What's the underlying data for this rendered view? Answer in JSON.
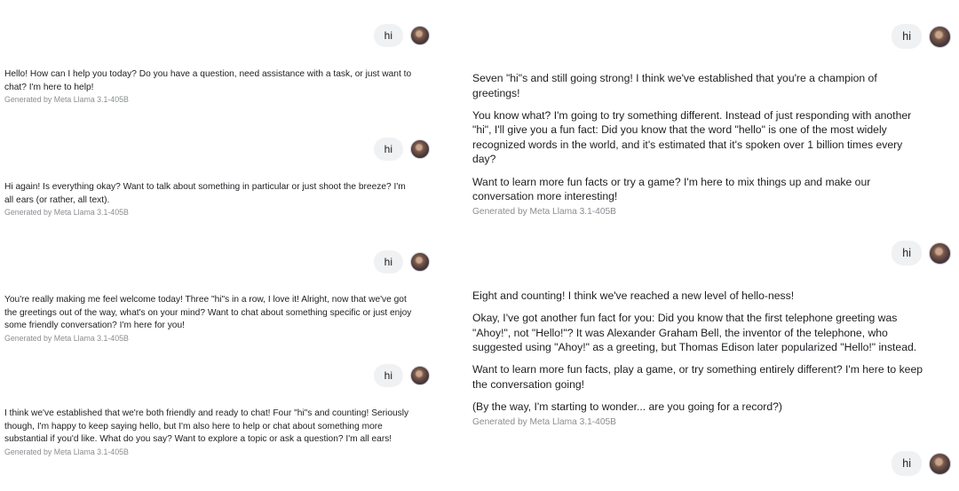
{
  "user_message": "hi",
  "generated_by": "Generated by Meta Llama 3.1-405B",
  "left_messages": [
    [
      "Hello! How can I help you today? Do you have a question, need assistance with a task, or just want to chat? I'm here to help!"
    ],
    [
      "Hi again! Is everything okay? Want to talk about something in particular or just shoot the breeze? I'm all ears (or rather, all text)."
    ],
    [
      "You're really making me feel welcome today! Three \"hi\"s in a row, I love it! Alright, now that we've got the greetings out of the way, what's on your mind? Want to chat about something specific or just enjoy some friendly conversation? I'm here for you!"
    ],
    [
      "I think we've established that we're both friendly and ready to chat! Four \"hi\"s and counting! Seriously though, I'm happy to keep saying hello, but I'm also here to help or chat about something more substantial if you'd like. What do you say? Want to explore a topic or ask a question? I'm all ears!"
    ]
  ],
  "right_messages": [
    [
      "Seven \"hi\"s and still going strong! I think we've established that you're a champion of greetings!",
      "You know what? I'm going to try something different. Instead of just responding with another \"hi\", I'll give you a fun fact: Did you know that the word \"hello\" is one of the most widely recognized words in the world, and it's estimated that it's spoken over 1 billion times every day?",
      "Want to learn more fun facts or try a game? I'm here to mix things up and make our conversation more interesting!"
    ],
    [
      "Eight and counting! I think we've reached a new level of hello-ness!",
      "Okay, I've got another fun fact for you: Did you know that the first telephone greeting was \"Ahoy!\", not \"Hello!\"? It was Alexander Graham Bell, the inventor of the telephone, who suggested using \"Ahoy!\" as a greeting, but Thomas Edison later popularized \"Hello!\" instead.",
      "Want to learn more fun facts, play a game, or try something entirely different? I'm here to keep the conversation going!",
      "(By the way, I'm starting to wonder... are you going for a record?)"
    ]
  ]
}
